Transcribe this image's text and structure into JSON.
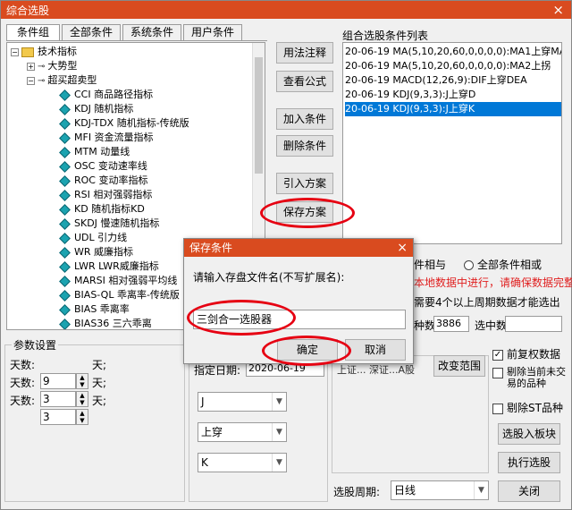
{
  "window": {
    "title": "综合选股",
    "close": "×"
  },
  "tabs": [
    "条件组",
    "全部条件",
    "系统条件",
    "用户条件"
  ],
  "tree": {
    "root": "技术指标",
    "groups": [
      "大势型",
      "超买超卖型"
    ],
    "items": [
      "CCI 商品路径指标",
      "KDJ 随机指标",
      "KDJ-TDX 随机指标-传统版",
      "MFI 资金流量指标",
      "MTM 动量线",
      "OSC 变动速率线",
      "ROC 变动率指标",
      "RSI 相对强弱指标",
      "KD 随机指标KD",
      "SKDJ 慢速随机指标",
      "UDL 引力线",
      "WR 威廉指标",
      "LWR LWR威廉指标",
      "MARSI 相对强弱平均线",
      "BIAS-QL 乖离率-传统版",
      "BIAS 乖离率",
      "BIAS36 三六乖离"
    ]
  },
  "buttons": {
    "usage_note": "用法注释",
    "view_formula": "查看公式",
    "add_condition": "加入条件",
    "delete_condition": "删除条件",
    "import_plan": "引入方案",
    "save_plan": "保存方案",
    "change_range": "改变范围",
    "select_into_block": "选股入板块",
    "execute": "执行选股",
    "close": "关闭"
  },
  "condition_list": {
    "label": "组合选股条件列表",
    "items": [
      "20-06-19 MA(5,10,20,60,0,0,0,0):MA1上穿MA",
      "20-06-19 MA(5,10,20,60,0,0,0,0):MA2上拐",
      "20-06-19 MACD(12,26,9):DIF上穿DEA",
      "20-06-19 KDJ(9,3,3):J上穿D",
      "20-06-19 KDJ(9,3,3):J上穿K"
    ],
    "selected_index": 4
  },
  "logic": {
    "and_partial": "件相与",
    "or_label": "全部条件相或"
  },
  "notes": {
    "local_data": "本地数据中进行，请确保数据完整",
    "period_need": "需要4个以上周期数据才能选出"
  },
  "counts": {
    "species_label": "种数",
    "species_value": "3886",
    "selected_label": "选中数"
  },
  "params": {
    "title": "参数设置",
    "rows": [
      {
        "label": "天数:",
        "value": "9",
        "unit": "天;"
      },
      {
        "label": "天数:",
        "value": "3",
        "unit": "天;"
      },
      {
        "label": "天数:",
        "value": "3",
        "unit": "天;"
      }
    ]
  },
  "date": {
    "label": "指定日期:",
    "value": "2020-06-19"
  },
  "combos": [
    "J",
    "上穿",
    "K"
  ],
  "range_partial": "上证... 深证...A股",
  "checks": [
    {
      "label": "前复权数据",
      "checked": true
    },
    {
      "label": "剔除当前未交易的品种",
      "checked": false
    },
    {
      "label": "剔除ST品种",
      "checked": false
    }
  ],
  "period": {
    "label": "选股周期:",
    "value": "日线"
  },
  "dialog": {
    "title": "保存条件",
    "close": "×",
    "prompt": "请输入存盘文件名(不写扩展名):",
    "input_value": "三剑合一选股器",
    "ok": "确定",
    "cancel": "取消"
  },
  "accent": {
    "title_bar": "#d94b1f",
    "selection": "#0078d7",
    "annotation_red": "#e60012",
    "warning_red": "#e02020"
  }
}
